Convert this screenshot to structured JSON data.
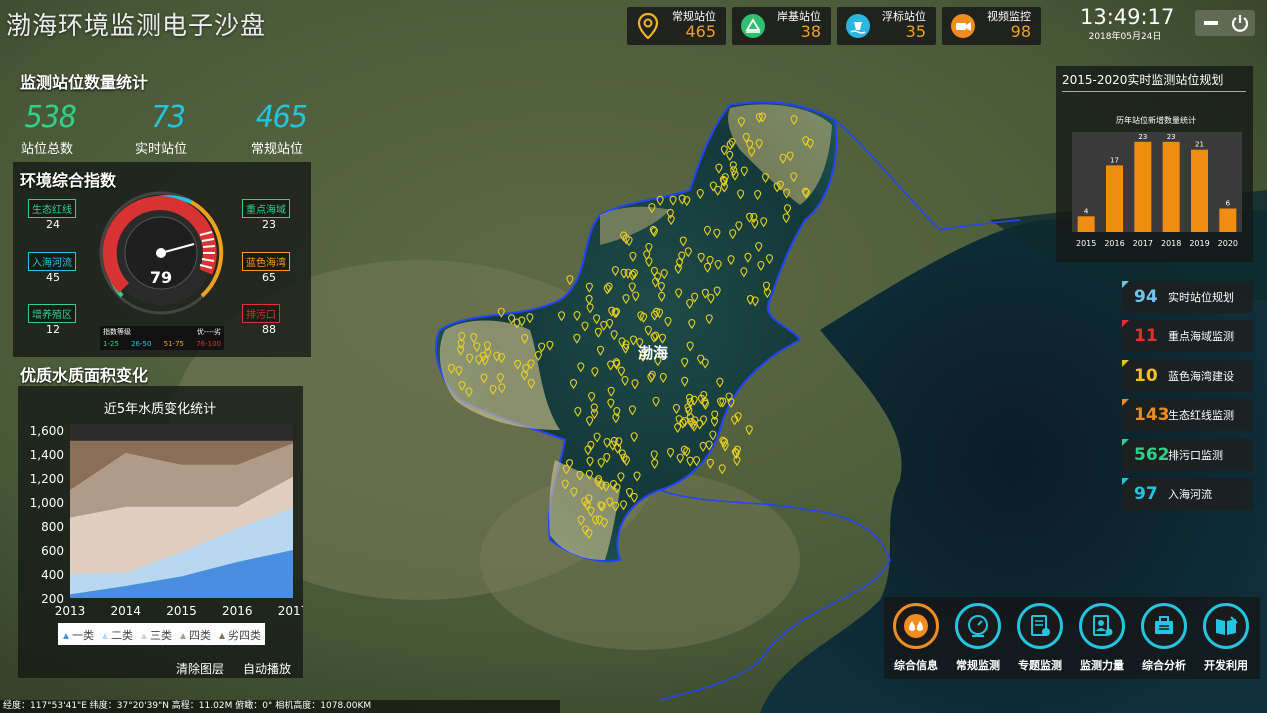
{
  "app": {
    "title": "渤海环境监测电子沙盘"
  },
  "topbar": {
    "stats": [
      {
        "label": "常规站位",
        "value": "465",
        "icon": "location-pin-icon",
        "color": "#f0b429"
      },
      {
        "label": "岸基站位",
        "value": "38",
        "icon": "shore-station-icon",
        "color": "#2fbf71"
      },
      {
        "label": "浮标站位",
        "value": "35",
        "icon": "buoy-icon",
        "color": "#2ab6e0"
      },
      {
        "label": "视频监控",
        "value": "98",
        "icon": "video-camera-icon",
        "color": "#f08c20"
      }
    ],
    "time": "13:49:17",
    "date": "2018年05月24日"
  },
  "station_count": {
    "title": "监测站位数量统计",
    "items": [
      {
        "value": "538",
        "label": "站位总数",
        "color": "#2fd08a"
      },
      {
        "value": "73",
        "label": "实时站位",
        "color": "#22c4e0"
      },
      {
        "value": "465",
        "label": "常规站位",
        "color": "#22c4e0"
      }
    ]
  },
  "env_index": {
    "title": "环境综合指数",
    "gauge_value": "79",
    "gauge_level": 0.79,
    "tags_left": [
      {
        "label": "生态红线",
        "value": "24",
        "color": "#2fd08a"
      },
      {
        "label": "入海河流",
        "value": "45",
        "color": "#22c4e0"
      },
      {
        "label": "增养殖区",
        "value": "12",
        "color": "#2fd08a"
      }
    ],
    "tags_right": [
      {
        "label": "重点海域",
        "value": "23",
        "color": "#2fd08a"
      },
      {
        "label": "蓝色海湾",
        "value": "65",
        "color": "#f0a020"
      },
      {
        "label": "排污口",
        "value": "88",
        "color": "#e03030"
      }
    ],
    "legend_title": "指数等级",
    "legend_range": "优----劣",
    "legend_items": [
      {
        "text": "1-25",
        "color": "#2fd08a"
      },
      {
        "text": "26-50",
        "color": "#22c4e0"
      },
      {
        "text": "51-75",
        "color": "#f0a020"
      },
      {
        "text": "76-100",
        "color": "#e03030"
      }
    ]
  },
  "water_quality": {
    "title": "优质水质面积变化",
    "buttons": {
      "clear": "清除图层",
      "autoplay": "自动播放"
    }
  },
  "chart_data": [
    {
      "type": "area",
      "title": "近5年水质变化统计",
      "categories": [
        "2013",
        "2014",
        "2015",
        "2016",
        "2017"
      ],
      "ylim": [
        200,
        1600
      ],
      "yticks": [
        "1,600",
        "1,400",
        "1,200",
        "1,000",
        "800",
        "600",
        "400",
        "200"
      ],
      "legend_position": "bottom",
      "series": [
        {
          "name": "一类",
          "values": [
            230,
            300,
            380,
            500,
            600
          ],
          "color": "#4a8ee0"
        },
        {
          "name": "二类",
          "values": [
            400,
            410,
            580,
            780,
            950
          ],
          "color": "#b8d8f0"
        },
        {
          "name": "三类",
          "values": [
            870,
            960,
            960,
            960,
            1210
          ],
          "color": "#e0cfc0"
        },
        {
          "name": "四类",
          "values": [
            1100,
            1410,
            1310,
            1310,
            1490
          ],
          "color": "#b09a88"
        },
        {
          "name": "劣四类",
          "values": [
            1510,
            1510,
            1510,
            1510,
            1510
          ],
          "color": "#8a6e58"
        }
      ]
    },
    {
      "type": "bar",
      "title": "历年站位新增数量统计",
      "categories": [
        "2015",
        "2016",
        "2017",
        "2018",
        "2019",
        "2020"
      ],
      "values": [
        4,
        17,
        23,
        23,
        21,
        6
      ],
      "ylim": [
        0,
        25
      ],
      "color": "#f08c10"
    }
  ],
  "plan_panel": {
    "title": "2015-2020实时监测站位规划"
  },
  "right_list": [
    {
      "value": "94",
      "label": "实时站位规划",
      "color": "#6ec6f0"
    },
    {
      "value": "11",
      "label": "重点海域监测",
      "color": "#e03030"
    },
    {
      "value": "10",
      "label": "蓝色海湾建设",
      "color": "#f0c020"
    },
    {
      "value": "143",
      "label": "生态红线监测",
      "color": "#f08c20"
    },
    {
      "value": "562",
      "label": "排污口监测",
      "color": "#2fd08a"
    },
    {
      "value": "97",
      "label": "入海河流",
      "color": "#22c4e0"
    }
  ],
  "map": {
    "sea_label": "渤海"
  },
  "bottom_nav": [
    {
      "label": "综合信息",
      "icon": "water-drops-icon",
      "color": "#f08c20"
    },
    {
      "label": "常规监测",
      "icon": "monitor-gauge-icon",
      "color": "#22c4e0"
    },
    {
      "label": "专题监测",
      "icon": "document-chart-icon",
      "color": "#22c4e0"
    },
    {
      "label": "监测力量",
      "icon": "person-document-icon",
      "color": "#22c4e0"
    },
    {
      "label": "综合分析",
      "icon": "briefcase-icon",
      "color": "#22c4e0"
    },
    {
      "label": "开发利用",
      "icon": "book-pen-icon",
      "color": "#22c4e0"
    }
  ],
  "status_bar": {
    "text": "经度：117°53'41\"E  纬度：37°20'39\"N  高程：11.02M      俯瞰：0°        相机高度：1078.00KM"
  }
}
